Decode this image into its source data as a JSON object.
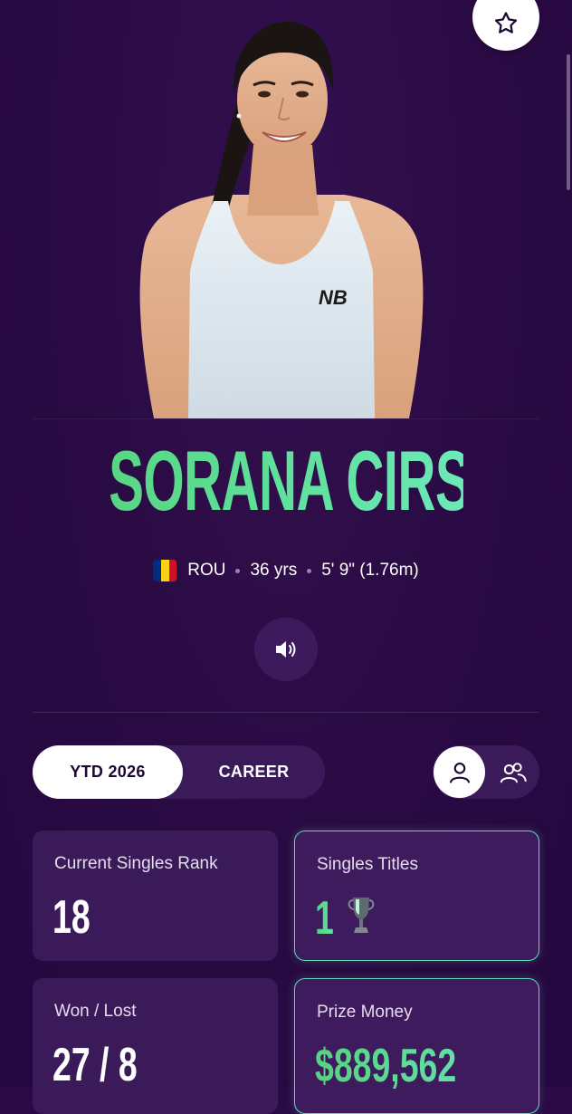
{
  "player": {
    "name": "SORANA CIRSTEA",
    "country": "ROU",
    "age": "36 yrs",
    "height": "5' 9\" (1.76m)",
    "flag_colors": [
      "#002b7f",
      "#fcd116",
      "#ce1126"
    ]
  },
  "toggle": {
    "ytd_label": "YTD 2026",
    "career_label": "CAREER",
    "selected": "YTD 2026"
  },
  "player_type": {
    "selected": "singles"
  },
  "stats": {
    "rank_label": "Current Singles Rank",
    "rank_value": "18",
    "titles_label": "Singles Titles",
    "titles_value": "1",
    "wonlost_label": "Won / Lost",
    "wonlost_value": "27 / 8",
    "prize_label": "Prize Money",
    "prize_value": "$889,562"
  },
  "icons": {
    "favorite": "star-icon",
    "audio": "speaker-icon",
    "singles": "user-icon",
    "doubles": "users-icon",
    "titles": "trophy-icon"
  },
  "colors": {
    "background": "#2a0a45",
    "accent_green": "#5fe09c",
    "card": "#3a1a58",
    "highlight_border": "#5fd9b5"
  }
}
